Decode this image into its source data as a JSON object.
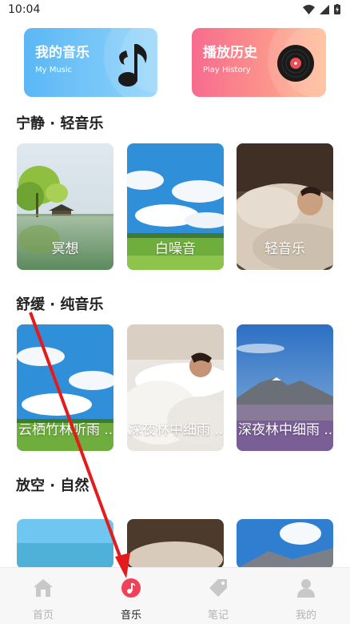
{
  "status": {
    "time": "10:04"
  },
  "top_cards": {
    "music": {
      "title": "我的音乐",
      "subtitle": "My Music"
    },
    "history": {
      "title": "播放历史",
      "subtitle": "Play History"
    }
  },
  "sections": [
    {
      "title": "宁静 · 轻音乐",
      "tiles": [
        "冥想",
        "白噪音",
        "轻音乐"
      ]
    },
    {
      "title": "舒缓 · 纯音乐",
      "tiles": [
        "云栖竹林听雨 ...",
        "深夜林中细雨 ...",
        "深夜林中细雨 ..."
      ]
    },
    {
      "title": "放空 · 自然"
    }
  ],
  "nav": [
    "首页",
    "音乐",
    "笔记",
    "我的"
  ],
  "colors": {
    "accent": "#f0405a",
    "music_card": "#5bb7f5",
    "history_card": "#f76b8e"
  }
}
